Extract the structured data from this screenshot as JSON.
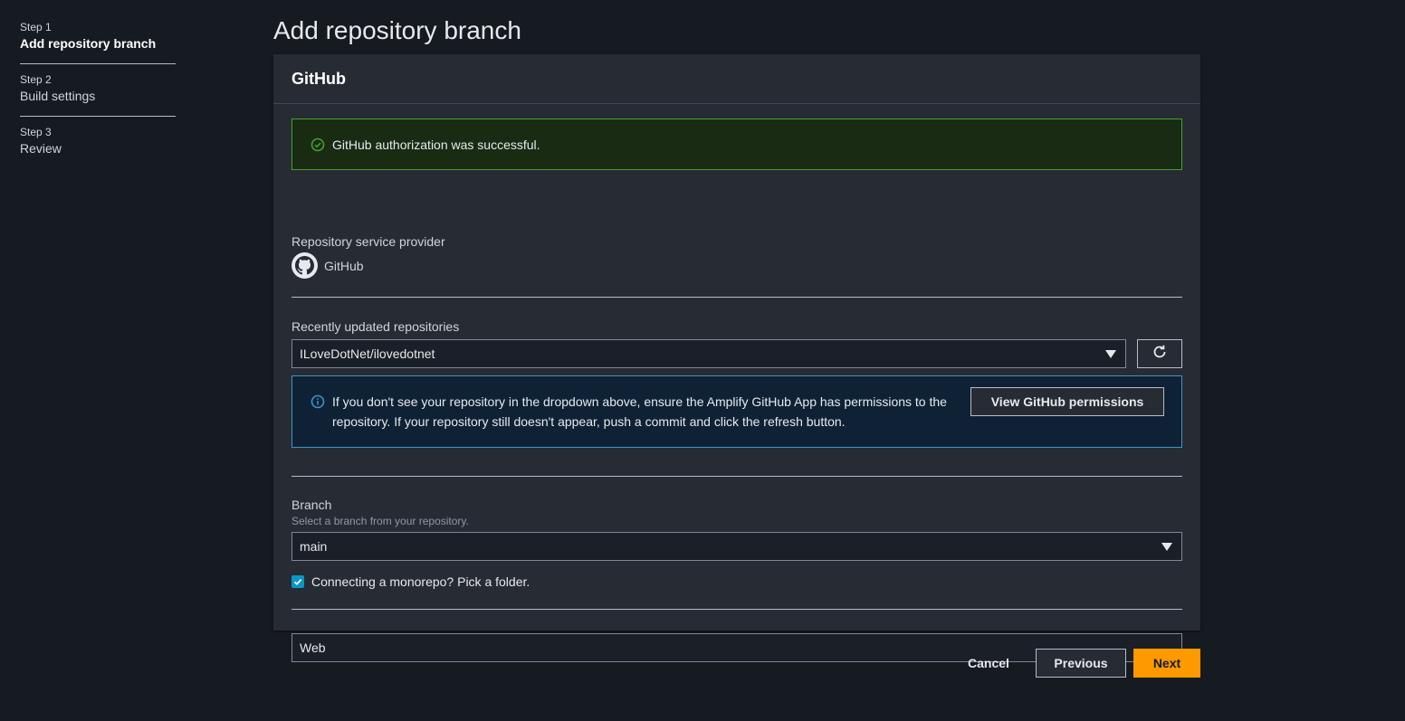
{
  "stepper": {
    "steps": [
      {
        "number": "Step 1",
        "label": "Add repository branch",
        "active": true
      },
      {
        "number": "Step 2",
        "label": "Build settings",
        "active": false
      },
      {
        "number": "Step 3",
        "label": "Review",
        "active": false
      }
    ]
  },
  "page": {
    "title": "Add repository branch"
  },
  "panel": {
    "header": "GitHub",
    "success_alert": {
      "icon": "check-circle-icon",
      "text": "GitHub authorization was successful."
    },
    "provider": {
      "label": "Repository service provider",
      "value": "GitHub",
      "icon": "github-icon"
    },
    "repository": {
      "label": "Recently updated repositories",
      "selected": "ILoveDotNet/ilovedotnet",
      "refresh_icon": "refresh-icon"
    },
    "info_alert": {
      "icon": "info-icon",
      "text": "If you don't see your repository in the dropdown above, ensure the Amplify GitHub App has permissions to the repository. If your repository still doesn't appear, push a commit and click the refresh button.",
      "button": "View GitHub permissions"
    },
    "branch": {
      "label": "Branch",
      "description": "Select a branch from your repository.",
      "selected": "main"
    },
    "monorepo": {
      "label": "Connecting a monorepo? Pick a folder.",
      "checked": true
    },
    "folder": {
      "value": "Web"
    }
  },
  "footer": {
    "cancel": "Cancel",
    "previous": "Previous",
    "next": "Next"
  },
  "colors": {
    "accent": "#ff9900",
    "success": "#41a32d",
    "info": "#3c95c4",
    "checkbox": "#0a97c8"
  }
}
